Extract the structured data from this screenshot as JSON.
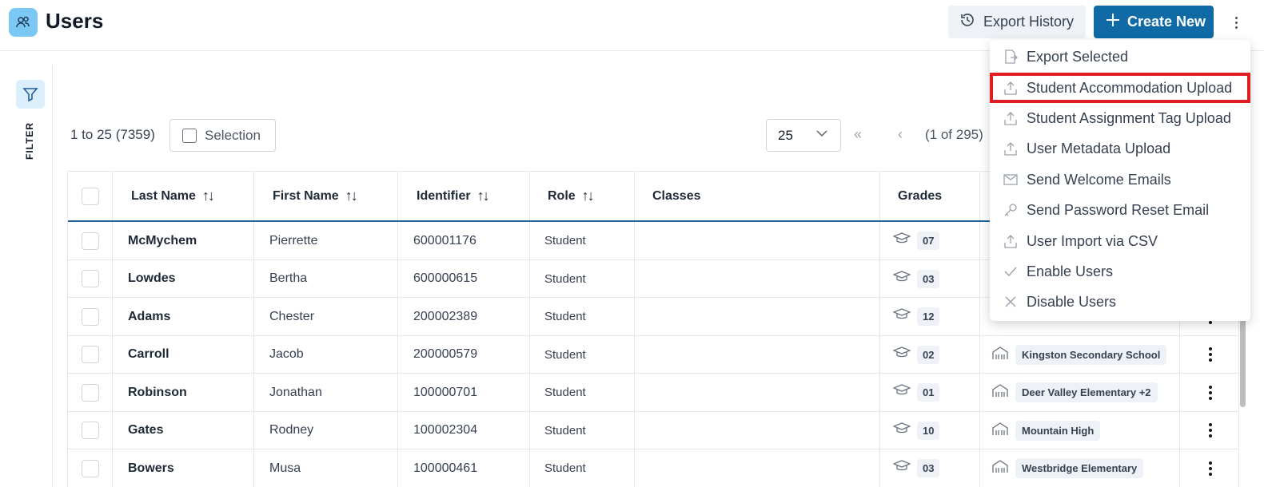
{
  "header": {
    "title": "Users",
    "export_history_label": "Export History",
    "create_new_label": "Create New"
  },
  "rail": {
    "filter_label": "FILTER"
  },
  "toolbar": {
    "range": "1 to 25 (7359)",
    "selection_label": "Selection",
    "page_size": "25",
    "page_info": "(1 of 295)"
  },
  "table": {
    "columns": [
      "Last Name",
      "First Name",
      "Identifier",
      "Role",
      "Classes",
      "Grades"
    ],
    "rows": [
      {
        "last": "McMychem",
        "first": "Pierrette",
        "id": "600001176",
        "role": "Student",
        "grade": "07",
        "school": ""
      },
      {
        "last": "Lowdes",
        "first": "Bertha",
        "id": "600000615",
        "role": "Student",
        "grade": "03",
        "school": ""
      },
      {
        "last": "Adams",
        "first": "Chester",
        "id": "200002389",
        "role": "Student",
        "grade": "12",
        "school": ""
      },
      {
        "last": "Carroll",
        "first": "Jacob",
        "id": "200000579",
        "role": "Student",
        "grade": "02",
        "school": "Kingston Secondary School"
      },
      {
        "last": "Robinson",
        "first": "Jonathan",
        "id": "100000701",
        "role": "Student",
        "grade": "01",
        "school": "Deer Valley Elementary +2"
      },
      {
        "last": "Gates",
        "first": "Rodney",
        "id": "100002304",
        "role": "Student",
        "grade": "10",
        "school": "Mountain High"
      },
      {
        "last": "Bowers",
        "first": "Musa",
        "id": "100000461",
        "role": "Student",
        "grade": "03",
        "school": "Westbridge Elementary"
      }
    ]
  },
  "menu": {
    "items": [
      {
        "label": "Export Selected",
        "icon": "export-file-icon"
      },
      {
        "label": "Student Accommodation Upload",
        "icon": "upload-icon"
      },
      {
        "label": "Student Assignment Tag Upload",
        "icon": "upload-icon"
      },
      {
        "label": "User Metadata Upload",
        "icon": "upload-icon"
      },
      {
        "label": "Send Welcome Emails",
        "icon": "mail-icon"
      },
      {
        "label": "Send Password Reset Email",
        "icon": "key-icon"
      },
      {
        "label": "User Import via CSV",
        "icon": "upload-icon"
      },
      {
        "label": "Enable Users",
        "icon": "check-icon"
      },
      {
        "label": "Disable Users",
        "icon": "x-icon"
      }
    ],
    "highlighted_index": 1,
    "highlight_color": "#e11d24"
  },
  "colors": {
    "primary": "#0f6aa6",
    "accent_light": "#7cc8f5",
    "header_rule": "#1f5f99"
  }
}
